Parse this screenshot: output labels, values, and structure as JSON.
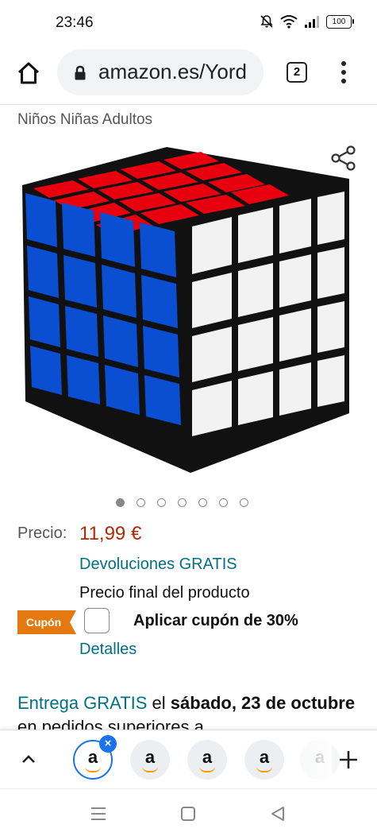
{
  "status_bar": {
    "time": "23:46",
    "battery": "100",
    "icons": [
      "bell-off-icon",
      "wifi-icon",
      "signal-icon",
      "battery-icon"
    ]
  },
  "browser": {
    "url": "amazon.es/Yord",
    "tab_count": "2",
    "icons": [
      "home-icon",
      "lock-icon",
      "menu-dots-icon"
    ]
  },
  "product": {
    "subtitle": "Niños Niñas Adultos",
    "image_alt": "rubiks-cube-4x4-image",
    "carousel": {
      "total": 7,
      "active_index": 0
    },
    "price_label": "Precio:",
    "price": "11,99 €",
    "returns": "Devoluciones GRATIS",
    "final_price_note": "Precio final del producto",
    "coupon_badge": "Cupón",
    "coupon_text": "Aplicar cupón de 30%",
    "details": "Detalles"
  },
  "delivery": {
    "green_part": "Entrega GRATIS",
    "mid_part": " el ",
    "bold_part": "sábado, 23 de octubre",
    "rest": " en pedidos superiores a"
  },
  "tab_strip": {
    "tab_letter": "a",
    "close_symbol": "×",
    "add_symbol": "+"
  },
  "colors": {
    "accent_blue": "#1a73e8",
    "link_teal": "#007185",
    "price_red": "#b12704",
    "coupon_orange": "#e47911"
  }
}
